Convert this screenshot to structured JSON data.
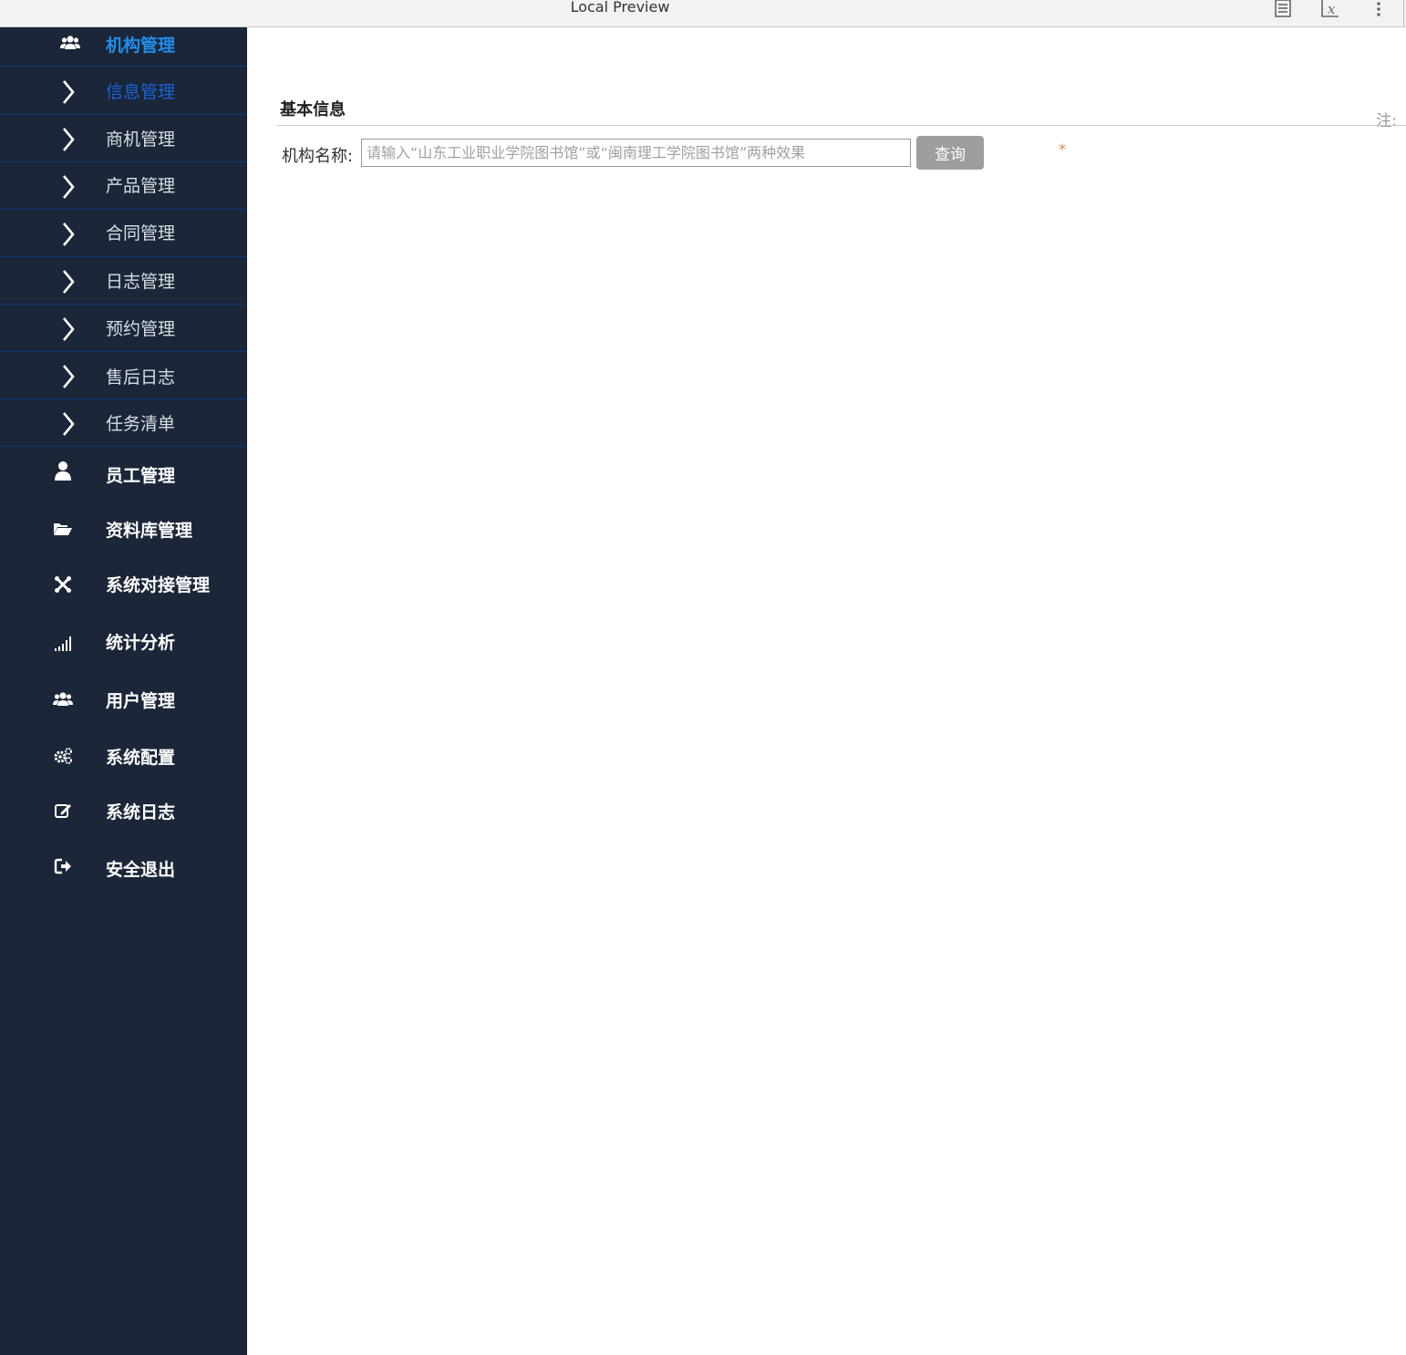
{
  "window": {
    "title": "Local Preview"
  },
  "sidebar": {
    "top": {
      "label": "机构管理",
      "icon": "users-icon"
    },
    "sub_items": [
      {
        "label": "信息管理",
        "active": true
      },
      {
        "label": "商机管理"
      },
      {
        "label": "产品管理"
      },
      {
        "label": "合同管理"
      },
      {
        "label": "日志管理"
      },
      {
        "label": "预约管理"
      },
      {
        "label": "售后日志"
      },
      {
        "label": "任务清单"
      }
    ],
    "main_items": [
      {
        "label": "员工管理",
        "icon": "user-icon"
      },
      {
        "label": "资料库管理",
        "icon": "folder-open-icon"
      },
      {
        "label": "系统对接管理",
        "icon": "joomla-icon"
      },
      {
        "label": "统计分析",
        "icon": "signal-icon"
      },
      {
        "label": "用户管理",
        "icon": "users-icon"
      },
      {
        "label": "系统配置",
        "icon": "gears-icon"
      },
      {
        "label": "系统日志",
        "icon": "edit-icon"
      },
      {
        "label": "安全退出",
        "icon": "sign-out-icon"
      }
    ]
  },
  "content": {
    "section_title": "基本信息",
    "note": "注:",
    "form": {
      "label": "机构名称:",
      "placeholder": "请输入“山东工业职业学院图书馆”或“闽南理工学院图书馆”两种效果",
      "value": "",
      "query_button": "查询",
      "required_mark": "*"
    }
  },
  "colors": {
    "sidebar_bg": "#1b2639",
    "divider": "#0d3a78",
    "active_top": "#1f8fea",
    "active_sub": "#1a63d8",
    "button_bg": "#9e9e9e",
    "required": "#d98a3a"
  }
}
